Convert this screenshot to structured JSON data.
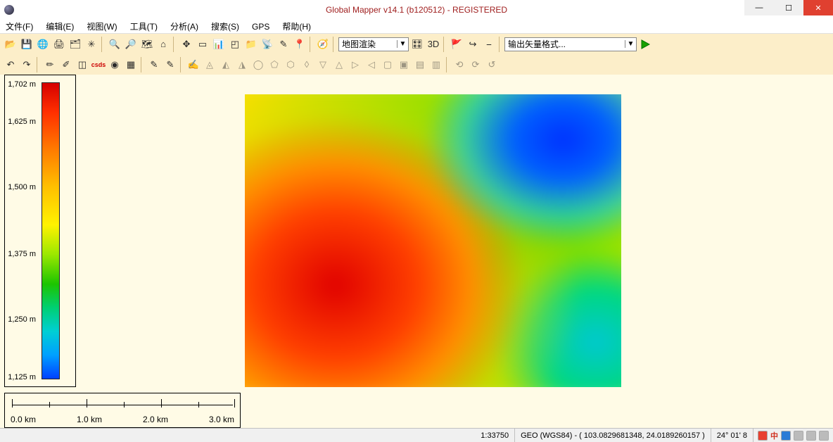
{
  "title": "Global Mapper v14.1 (b120512) - REGISTERED",
  "menus": [
    "文件(F)",
    "编辑(E)",
    "视图(W)",
    "工具(T)",
    "分析(A)",
    "搜索(S)",
    "GPS",
    "帮助(H)"
  ],
  "combo_map": "地图渲染",
  "combo_vector": "输出矢量格式...",
  "chart_data": {
    "type": "heatmap",
    "title": "",
    "colormap": "elevation-rainbow",
    "min_value": 1125,
    "max_value": 1702,
    "unit": "m"
  },
  "legend": {
    "ticks": [
      {
        "v": "1,702 m",
        "p": 0.02
      },
      {
        "v": "1,625 m",
        "p": 0.14
      },
      {
        "v": "1,500 m",
        "p": 0.35
      },
      {
        "v": "1,375 m",
        "p": 0.56
      },
      {
        "v": "1,250 m",
        "p": 0.77
      },
      {
        "v": "1,125 m",
        "p": 0.98
      }
    ]
  },
  "scalebar": {
    "labels": [
      "0.0 km",
      "1.0 km",
      "2.0 km",
      "3.0 km"
    ]
  },
  "status": {
    "scale": "1:33750",
    "crs": "GEO (WGS84) - ( 103.0829681348, 24.0189260157 )",
    "dms": "24° 01' 8"
  },
  "tray_lang": "中"
}
